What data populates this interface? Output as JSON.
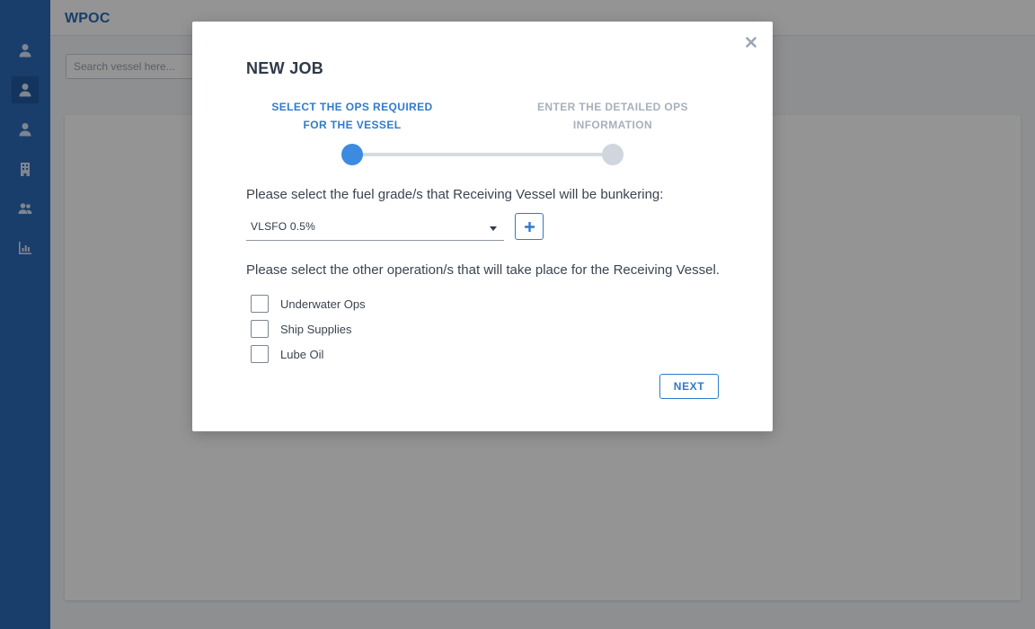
{
  "app": {
    "brand": "WPOC"
  },
  "sidebar": {
    "items": [
      {
        "icon": "user-icon",
        "active": false
      },
      {
        "icon": "user-icon",
        "active": true
      },
      {
        "icon": "user-icon",
        "active": false
      },
      {
        "icon": "building-icon",
        "active": false
      },
      {
        "icon": "users-icon",
        "active": false
      },
      {
        "icon": "bar-chart-icon",
        "active": false
      }
    ]
  },
  "search": {
    "placeholder": "Search vessel here..."
  },
  "modal": {
    "title": "NEW JOB",
    "steps": [
      {
        "line1": "SELECT THE OPS REQUIRED",
        "line2": "FOR THE VESSEL",
        "state": "active"
      },
      {
        "line1": "ENTER THE DETAILED OPS",
        "line2": "INFORMATION",
        "state": "inactive"
      }
    ],
    "fuel_prompt": "Please select the fuel grade/s that Receiving Vessel will be bunkering:",
    "fuel_select": {
      "value": "VLSFO 0.5%"
    },
    "ops_prompt": "Please select the other operation/s that will take place for the Receiving Vessel.",
    "operations": [
      {
        "label": "Underwater Ops",
        "checked": false
      },
      {
        "label": "Ship Supplies",
        "checked": false
      },
      {
        "label": "Lube Oil",
        "checked": false
      }
    ],
    "next_label": "NEXT"
  },
  "colors": {
    "sidebar": "#2b6cb8",
    "accent": "#2f7bcd",
    "step_active": "#3d8be0",
    "step_inactive": "#cfd6de"
  }
}
